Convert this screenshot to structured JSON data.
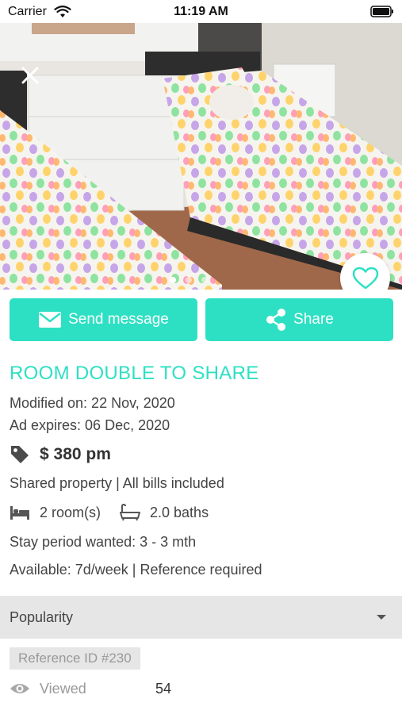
{
  "status_bar": {
    "carrier": "Carrier",
    "time": "11:19 AM"
  },
  "listing": {
    "photo": {
      "pages": 3,
      "active_page": 1
    },
    "title": "ROOM DOUBLE TO SHARE",
    "modified": "Modified on: 22 Nov, 2020",
    "expires": "Ad expires: 06 Dec, 2020",
    "price": "$ 380 pm",
    "property": "Shared property | All bills included",
    "rooms": "2 room(s)",
    "baths": "2.0 baths",
    "stay_period": "Stay period wanted: 3 - 3 mth",
    "availability": "Available: 7d/week |  Reference required"
  },
  "actions": {
    "send_message": "Send message",
    "share": "Share"
  },
  "popularity": {
    "label": "Popularity"
  },
  "reference": {
    "id": "Reference ID #230"
  },
  "views": {
    "label": "Viewed",
    "count": "54"
  },
  "colors": {
    "accent": "#2ee0c3",
    "section_bg": "#e6e6e6",
    "muted_text": "#999999"
  },
  "icons": [
    "wifi-icon",
    "battery-icon",
    "close-icon",
    "heart-icon",
    "envelope-icon",
    "share-icon",
    "price-tag-icon",
    "bed-icon",
    "bathtub-icon",
    "caret-down-icon",
    "eye-icon"
  ]
}
